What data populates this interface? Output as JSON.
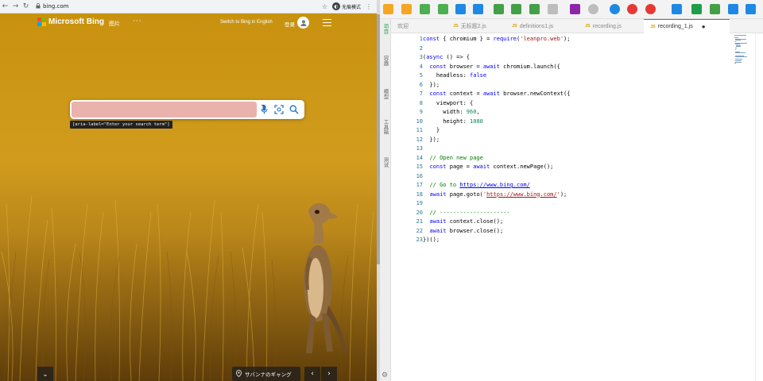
{
  "browser": {
    "url": "bing.com",
    "incognito_label": "无痕模式",
    "nav": {
      "back": "←",
      "forward": "→",
      "reload": "↻"
    }
  },
  "bing": {
    "logo_text": "Microsoft Bing",
    "images_tab": "图片",
    "more": "···",
    "switch_language": "Switch to Bing in English",
    "sign_in": "登录",
    "search": {
      "value": "",
      "placeholder": "",
      "cursor": "I"
    },
    "aria_tooltip": "[aria-label=\"Enter your search term\"]",
    "location": "サバンナのギャング",
    "prev": "‹",
    "next": "›",
    "collapse": "⌄"
  },
  "ide": {
    "sidebar_tabs": [
      "项目",
      "容器",
      "模型",
      "工具箱",
      "测试"
    ],
    "tabs": [
      {
        "label": "欢迎",
        "has_js": false,
        "active": false
      },
      {
        "label": "无标题2.js",
        "has_js": true,
        "active": false
      },
      {
        "label": "definitions1.js",
        "has_js": true,
        "active": false
      },
      {
        "label": "recording.js",
        "has_js": true,
        "active": false
      },
      {
        "label": "recording_1.js",
        "has_js": true,
        "active": true,
        "modified": true
      }
    ],
    "js_badge": "JS",
    "modified_dot": "●",
    "toolbar_colors": [
      "#f5a623",
      "#f5a623",
      "#4caf50",
      "#4caf50",
      "#1e88e5",
      "#1e88e5",
      "#43a047",
      "#43a047",
      "#43a047",
      "#bdbdbd",
      "#8e24aa",
      "#bdbdbd",
      "#1e88e5",
      "#e53935",
      "#e53935",
      "#1e88e5",
      "#1e9e49",
      "#43a047",
      "#1e88e5",
      "#1e88e5"
    ],
    "line_numbers": [
      "1",
      "2",
      "3",
      "4",
      "5",
      "6",
      "7",
      "8",
      "9",
      "10",
      "11",
      "12",
      "13",
      "14",
      "15",
      "16",
      "17",
      "18",
      "19",
      "20",
      "21",
      "22",
      "23"
    ],
    "code_lines": [
      [
        [
          "kw",
          "const"
        ],
        [
          "p",
          " { chromium } = "
        ],
        [
          "kw",
          "require"
        ],
        [
          "p",
          "("
        ],
        [
          "str",
          "'leanpro.web'"
        ],
        [
          "p",
          ");"
        ]
      ],
      [],
      [
        [
          "p",
          "("
        ],
        [
          "kw",
          "async"
        ],
        [
          "p",
          " () => {"
        ]
      ],
      [
        [
          "p",
          "  "
        ],
        [
          "kw",
          "const"
        ],
        [
          "p",
          " browser = "
        ],
        [
          "kw",
          "await"
        ],
        [
          "p",
          " chromium.launch({"
        ]
      ],
      [
        [
          "p",
          "    headless: "
        ],
        [
          "bool",
          "false"
        ]
      ],
      [
        [
          "p",
          "  });"
        ]
      ],
      [
        [
          "p",
          "  "
        ],
        [
          "kw",
          "const"
        ],
        [
          "p",
          " context = "
        ],
        [
          "kw",
          "await"
        ],
        [
          "p",
          " browser.newContext({"
        ]
      ],
      [
        [
          "p",
          "    viewport: {"
        ]
      ],
      [
        [
          "p",
          "      width: "
        ],
        [
          "num",
          "960"
        ],
        [
          "p",
          ","
        ]
      ],
      [
        [
          "p",
          "      height: "
        ],
        [
          "num",
          "1080"
        ]
      ],
      [
        [
          "p",
          "    }"
        ]
      ],
      [
        [
          "p",
          "  });"
        ]
      ],
      [],
      [
        [
          "cm",
          "  // Open new page"
        ]
      ],
      [
        [
          "p",
          "  "
        ],
        [
          "kw",
          "const"
        ],
        [
          "p",
          " page = "
        ],
        [
          "kw",
          "await"
        ],
        [
          "p",
          " context.newPage();"
        ]
      ],
      [],
      [
        [
          "cm",
          "  // Go to "
        ],
        [
          "url",
          "https://www.bing.com/"
        ]
      ],
      [
        [
          "p",
          "  "
        ],
        [
          "kw",
          "await"
        ],
        [
          "p",
          " page.goto("
        ],
        [
          "str",
          "'"
        ],
        [
          "urlstr",
          "https://www.bing.com/"
        ],
        [
          "str",
          "'"
        ],
        [
          "p",
          ");"
        ]
      ],
      [],
      [
        [
          "cm",
          "  // ---------------------"
        ]
      ],
      [
        [
          "p",
          "  "
        ],
        [
          "kw",
          "await"
        ],
        [
          "p",
          " context.close();"
        ]
      ],
      [
        [
          "p",
          "  "
        ],
        [
          "kw",
          "await"
        ],
        [
          "p",
          " browser.close();"
        ]
      ],
      [
        [
          "p",
          "})();"
        ]
      ]
    ]
  },
  "icons": {
    "lock": "lock-icon",
    "mic": "mic-icon",
    "visual_search": "visual-search-icon",
    "search": "search-icon",
    "location_pin": "location-pin-icon",
    "gear": "gear-icon"
  }
}
